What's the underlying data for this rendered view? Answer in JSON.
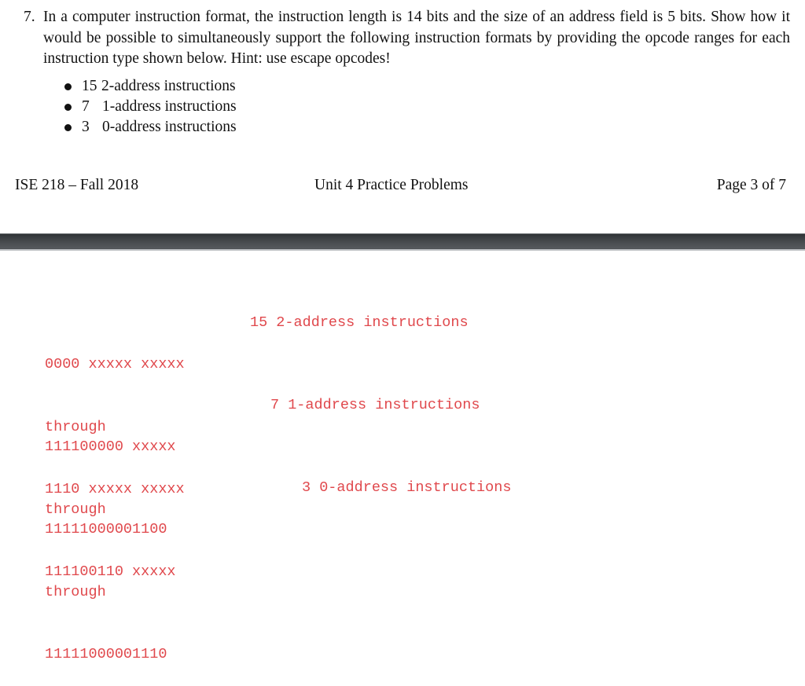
{
  "problem": {
    "number": "7.",
    "text": "In a computer instruction format, the instruction length is 14 bits and the size of an address field is 5 bits. Show how it would be possible to simultaneously support the following instruction formats by providing the opcode ranges for each instruction type shown below. Hint: use escape opcodes!",
    "bullets": [
      {
        "count": "15",
        "label": "2-address instructions"
      },
      {
        "count": "7",
        "label": "1-address instructions"
      },
      {
        "count": "3",
        "label": "0-address instructions"
      }
    ]
  },
  "footer": {
    "left": "ISE 218 – Fall 2018",
    "center": "Unit 4 Practice Problems",
    "right": "Page 3 of 7"
  },
  "answer": {
    "color": "#e0484c",
    "groups": [
      {
        "start": "0000 xxxxx xxxxx",
        "through": "through",
        "end": "1110 xxxxx xxxxx",
        "description": "15 2-address instructions"
      },
      {
        "start": "111100000 xxxxx",
        "through": "through",
        "end": "111100110 xxxxx",
        "description": "7 1-address instructions"
      },
      {
        "start": "11111000001100",
        "through": "through",
        "end": "11111000001110",
        "description": "3 0-address instructions"
      }
    ]
  }
}
